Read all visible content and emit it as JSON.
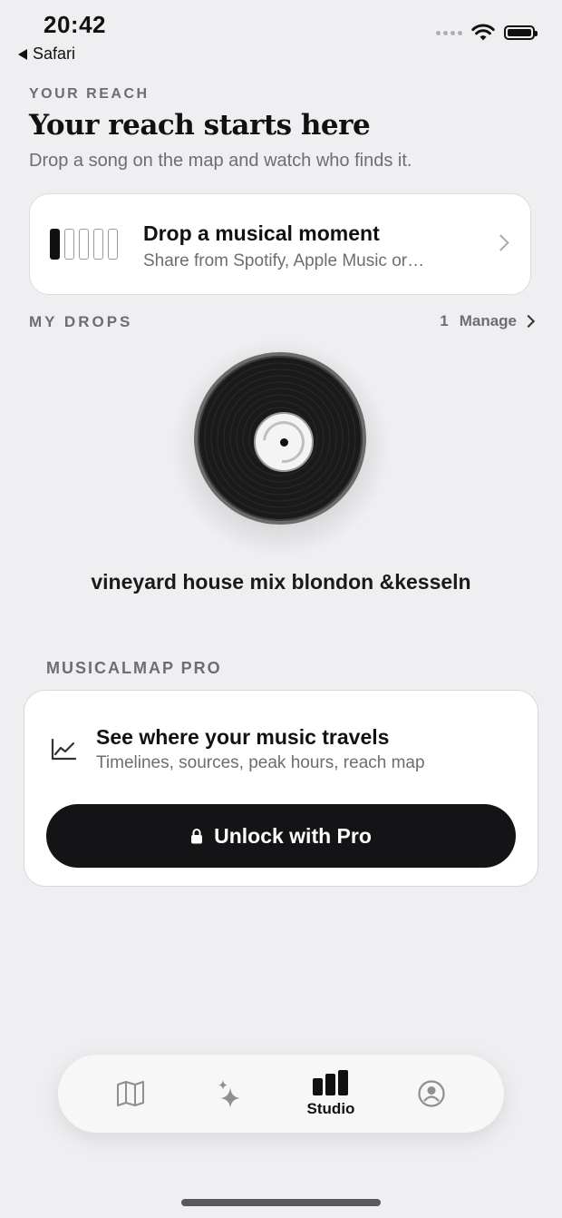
{
  "status_bar": {
    "time": "20:42",
    "back_app": "Safari"
  },
  "header": {
    "eyebrow": "YOUR REACH",
    "title": "Your reach starts here",
    "subtitle": "Drop a song on the map and watch who finds it."
  },
  "drop_card": {
    "title": "Drop a musical moment",
    "subtitle": "Share from Spotify, Apple Music or…"
  },
  "my_drops": {
    "label": "MY DROPS",
    "count": "1",
    "manage_label": "Manage",
    "track_name": "vineyard house mix blondon &kesseln"
  },
  "pro": {
    "label": "MUSICALMAP PRO",
    "title": "See where your music travels",
    "subtitle": "Timelines, sources, peak hours, reach map",
    "unlock_label": "Unlock with Pro"
  },
  "tabbar": {
    "tabs": [
      {
        "icon": "map-icon",
        "label": ""
      },
      {
        "icon": "sparkle-icon",
        "label": ""
      },
      {
        "icon": "studio-bars-icon",
        "label": "Studio",
        "selected": true
      },
      {
        "icon": "profile-icon",
        "label": ""
      }
    ]
  },
  "colors": {
    "background": "#efeff2",
    "button": "#141416",
    "muted_text": "#6d6d72"
  }
}
